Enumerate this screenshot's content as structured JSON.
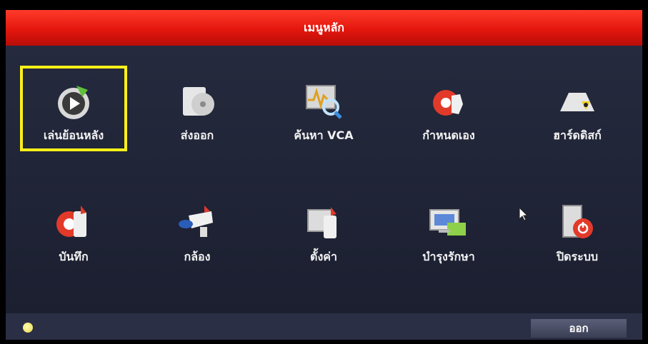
{
  "titlebar": {
    "title": "เมนูหลัก"
  },
  "menu": {
    "items": [
      {
        "label": "เล่นย้อนหลัง",
        "icon": "playback-icon",
        "selected": true
      },
      {
        "label": "ส่งออก",
        "icon": "export-icon",
        "selected": false
      },
      {
        "label": "ค้นหา VCA",
        "icon": "vca-search-icon",
        "selected": false
      },
      {
        "label": "กำหนดเอง",
        "icon": "custom-icon",
        "selected": false
      },
      {
        "label": "ฮาร์ดดิสก์",
        "icon": "hdd-icon",
        "selected": false
      },
      {
        "label": "บันทึก",
        "icon": "record-icon",
        "selected": false
      },
      {
        "label": "กล้อง",
        "icon": "camera-icon",
        "selected": false
      },
      {
        "label": "ตั้งค่า",
        "icon": "settings-icon",
        "selected": false
      },
      {
        "label": "บำรุงรักษา",
        "icon": "maintenance-icon",
        "selected": false
      },
      {
        "label": "ปิดระบบ",
        "icon": "shutdown-icon",
        "selected": false
      }
    ]
  },
  "footer": {
    "exit_label": "ออก",
    "status_icon": "status-led-icon"
  },
  "colors": {
    "titlebar": "#e3160e",
    "selection": "#fbf01a",
    "background": "#1a1d2b"
  }
}
